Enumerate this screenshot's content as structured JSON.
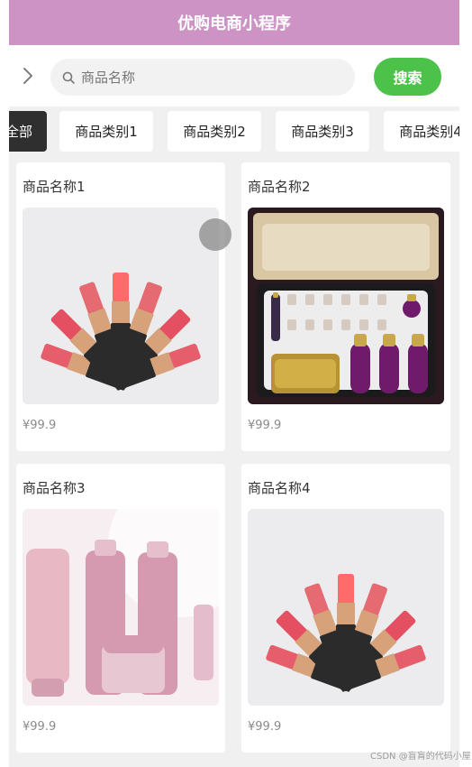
{
  "header": {
    "title": "优购电商小程序",
    "background": "#cd93c5"
  },
  "searchbar": {
    "expand_icon": "chevron-right-icon",
    "search_icon": "search-icon",
    "input_placeholder": "商品名称",
    "search_button_label": "搜索",
    "search_button_color": "#4cc24b"
  },
  "tabs": [
    {
      "label": "全部",
      "active": true
    },
    {
      "label": "商品类别1",
      "active": false
    },
    {
      "label": "商品类别2",
      "active": false
    },
    {
      "label": "商品类别3",
      "active": false
    },
    {
      "label": "商品类别4",
      "active": false
    }
  ],
  "products": [
    {
      "name": "商品名称1",
      "price": "¥99.9",
      "image": "lipsticks"
    },
    {
      "name": "商品名称2",
      "price": "¥99.9",
      "image": "skincare-box"
    },
    {
      "name": "商品名称3",
      "price": "¥99.9",
      "image": "pink-skincare-bottles"
    },
    {
      "name": "商品名称4",
      "price": "¥99.9",
      "image": "lipsticks"
    }
  ],
  "watermark": "CSDN @盲肓的代码小屋"
}
